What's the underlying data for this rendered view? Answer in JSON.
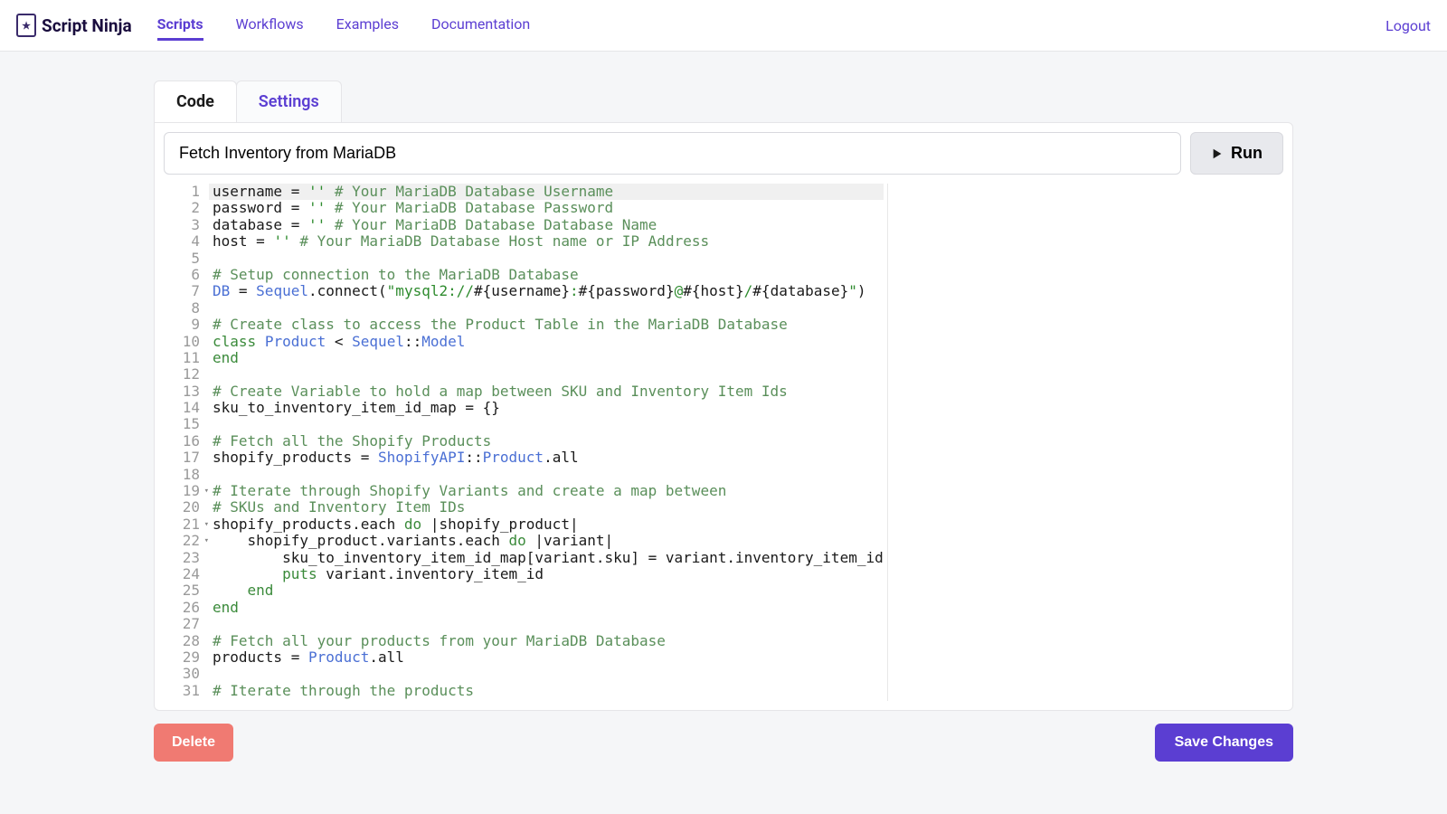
{
  "brand": "Script Ninja",
  "nav": {
    "items": [
      "Scripts",
      "Workflows",
      "Examples",
      "Documentation"
    ],
    "logout": "Logout"
  },
  "tabs": {
    "code": "Code",
    "settings": "Settings"
  },
  "title_input": {
    "value": "Fetch Inventory from MariaDB"
  },
  "run_label": "Run",
  "footer": {
    "delete": "Delete",
    "save": "Save Changes"
  },
  "code_lines": [
    {
      "n": 1,
      "fold": false,
      "hl": true,
      "segs": [
        {
          "t": "username "
        },
        {
          "t": "="
        },
        {
          "t": " "
        },
        {
          "t": "''",
          "c": "tk-str"
        },
        {
          "t": " "
        },
        {
          "t": "# Your MariaDB Database Username",
          "c": "tk-comment"
        }
      ]
    },
    {
      "n": 2,
      "fold": false,
      "segs": [
        {
          "t": "password "
        },
        {
          "t": "="
        },
        {
          "t": " "
        },
        {
          "t": "''",
          "c": "tk-str"
        },
        {
          "t": " "
        },
        {
          "t": "# Your MariaDB Database Password",
          "c": "tk-comment"
        }
      ]
    },
    {
      "n": 3,
      "fold": false,
      "segs": [
        {
          "t": "database "
        },
        {
          "t": "="
        },
        {
          "t": " "
        },
        {
          "t": "''",
          "c": "tk-str"
        },
        {
          "t": " "
        },
        {
          "t": "# Your MariaDB Database Database Name",
          "c": "tk-comment"
        }
      ]
    },
    {
      "n": 4,
      "fold": false,
      "segs": [
        {
          "t": "host "
        },
        {
          "t": "="
        },
        {
          "t": " "
        },
        {
          "t": "''",
          "c": "tk-str"
        },
        {
          "t": " "
        },
        {
          "t": "# Your MariaDB Database Host name or IP Address",
          "c": "tk-comment"
        }
      ]
    },
    {
      "n": 5,
      "fold": false,
      "segs": []
    },
    {
      "n": 6,
      "fold": false,
      "segs": [
        {
          "t": "# Setup connection to the MariaDB Database",
          "c": "tk-comment"
        }
      ]
    },
    {
      "n": 7,
      "fold": false,
      "segs": [
        {
          "t": "DB",
          "c": "tk-const"
        },
        {
          "t": " = "
        },
        {
          "t": "Sequel",
          "c": "tk-class"
        },
        {
          "t": ".connect("
        },
        {
          "t": "\"mysql2://",
          "c": "tk-str"
        },
        {
          "t": "#{username}"
        },
        {
          "t": ":",
          "c": "tk-str"
        },
        {
          "t": "#{password}"
        },
        {
          "t": "@",
          "c": "tk-str"
        },
        {
          "t": "#{host}"
        },
        {
          "t": "/",
          "c": "tk-str"
        },
        {
          "t": "#{database}"
        },
        {
          "t": "\"",
          "c": "tk-str"
        },
        {
          "t": ")"
        }
      ]
    },
    {
      "n": 8,
      "fold": false,
      "segs": []
    },
    {
      "n": 9,
      "fold": false,
      "segs": [
        {
          "t": "# Create class to access the Product Table in the MariaDB Database",
          "c": "tk-comment"
        }
      ]
    },
    {
      "n": 10,
      "fold": false,
      "segs": [
        {
          "t": "class",
          "c": "tk-kw"
        },
        {
          "t": " "
        },
        {
          "t": "Product",
          "c": "tk-class"
        },
        {
          "t": " < "
        },
        {
          "t": "Sequel",
          "c": "tk-class"
        },
        {
          "t": "::"
        },
        {
          "t": "Model",
          "c": "tk-class"
        }
      ]
    },
    {
      "n": 11,
      "fold": false,
      "segs": [
        {
          "t": "end",
          "c": "tk-kw"
        }
      ]
    },
    {
      "n": 12,
      "fold": false,
      "segs": []
    },
    {
      "n": 13,
      "fold": false,
      "segs": [
        {
          "t": "# Create Variable to hold a map between SKU and Inventory Item Ids",
          "c": "tk-comment"
        }
      ]
    },
    {
      "n": 14,
      "fold": false,
      "segs": [
        {
          "t": "sku_to_inventory_item_id_map = {}"
        }
      ]
    },
    {
      "n": 15,
      "fold": false,
      "segs": []
    },
    {
      "n": 16,
      "fold": false,
      "segs": [
        {
          "t": "# Fetch all the Shopify Products",
          "c": "tk-comment"
        }
      ]
    },
    {
      "n": 17,
      "fold": false,
      "segs": [
        {
          "t": "shopify_products = "
        },
        {
          "t": "ShopifyAPI",
          "c": "tk-class"
        },
        {
          "t": "::"
        },
        {
          "t": "Product",
          "c": "tk-class"
        },
        {
          "t": ".all"
        }
      ]
    },
    {
      "n": 18,
      "fold": false,
      "segs": []
    },
    {
      "n": 19,
      "fold": true,
      "segs": [
        {
          "t": "# Iterate through Shopify Variants and create a map between",
          "c": "tk-comment"
        }
      ]
    },
    {
      "n": 20,
      "fold": false,
      "segs": [
        {
          "t": "# SKUs and Inventory Item IDs",
          "c": "tk-comment"
        }
      ]
    },
    {
      "n": 21,
      "fold": true,
      "segs": [
        {
          "t": "shopify_products.each "
        },
        {
          "t": "do",
          "c": "tk-kw"
        },
        {
          "t": " |shopify_product|"
        }
      ]
    },
    {
      "n": 22,
      "fold": true,
      "segs": [
        {
          "t": "    shopify_product.variants.each "
        },
        {
          "t": "do",
          "c": "tk-kw"
        },
        {
          "t": " |variant|"
        }
      ]
    },
    {
      "n": 23,
      "fold": false,
      "segs": [
        {
          "t": "        sku_to_inventory_item_id_map[variant.sku] = variant.inventory_item_id"
        }
      ]
    },
    {
      "n": 24,
      "fold": false,
      "segs": [
        {
          "t": "        "
        },
        {
          "t": "puts",
          "c": "tk-kw"
        },
        {
          "t": " variant.inventory_item_id"
        }
      ]
    },
    {
      "n": 25,
      "fold": false,
      "segs": [
        {
          "t": "    "
        },
        {
          "t": "end",
          "c": "tk-kw"
        }
      ]
    },
    {
      "n": 26,
      "fold": false,
      "segs": [
        {
          "t": "end",
          "c": "tk-kw"
        }
      ]
    },
    {
      "n": 27,
      "fold": false,
      "segs": []
    },
    {
      "n": 28,
      "fold": false,
      "segs": [
        {
          "t": "# Fetch all your products from your MariaDB Database",
          "c": "tk-comment"
        }
      ]
    },
    {
      "n": 29,
      "fold": false,
      "segs": [
        {
          "t": "products = "
        },
        {
          "t": "Product",
          "c": "tk-class"
        },
        {
          "t": ".all"
        }
      ]
    },
    {
      "n": 30,
      "fold": false,
      "segs": []
    },
    {
      "n": 31,
      "fold": false,
      "segs": [
        {
          "t": "# Iterate through the products",
          "c": "tk-comment"
        }
      ]
    }
  ]
}
